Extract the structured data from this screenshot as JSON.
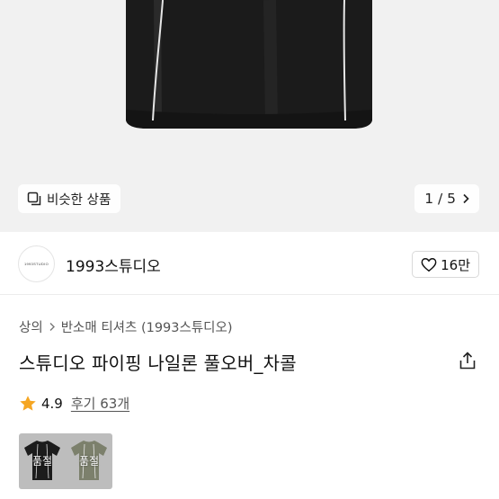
{
  "hero": {
    "similar_label": "비슷한 상품",
    "pager": "1 / 5"
  },
  "shop": {
    "logo_text": "1993STUDIO",
    "name": "1993스튜디오",
    "like_count": "16만"
  },
  "product": {
    "breadcrumb": [
      "상의",
      "반소매 티셔츠 (1993스튜디오)"
    ],
    "title": "스튜디오 파이핑 나일론 풀오버_차콜",
    "rating": "4.9",
    "reviews": "후기 63개"
  },
  "options": [
    {
      "label": "품절",
      "color": "#1c1c1c"
    },
    {
      "label": "품절",
      "color": "#7c806c"
    }
  ],
  "colors": {
    "hero_bg": "#f1f1f1",
    "garment": "#1a1a1a",
    "star": "#f5a623"
  },
  "icons": [
    "similar-items-icon",
    "chevron-right-icon",
    "heart-icon",
    "share-icon",
    "star-icon"
  ]
}
